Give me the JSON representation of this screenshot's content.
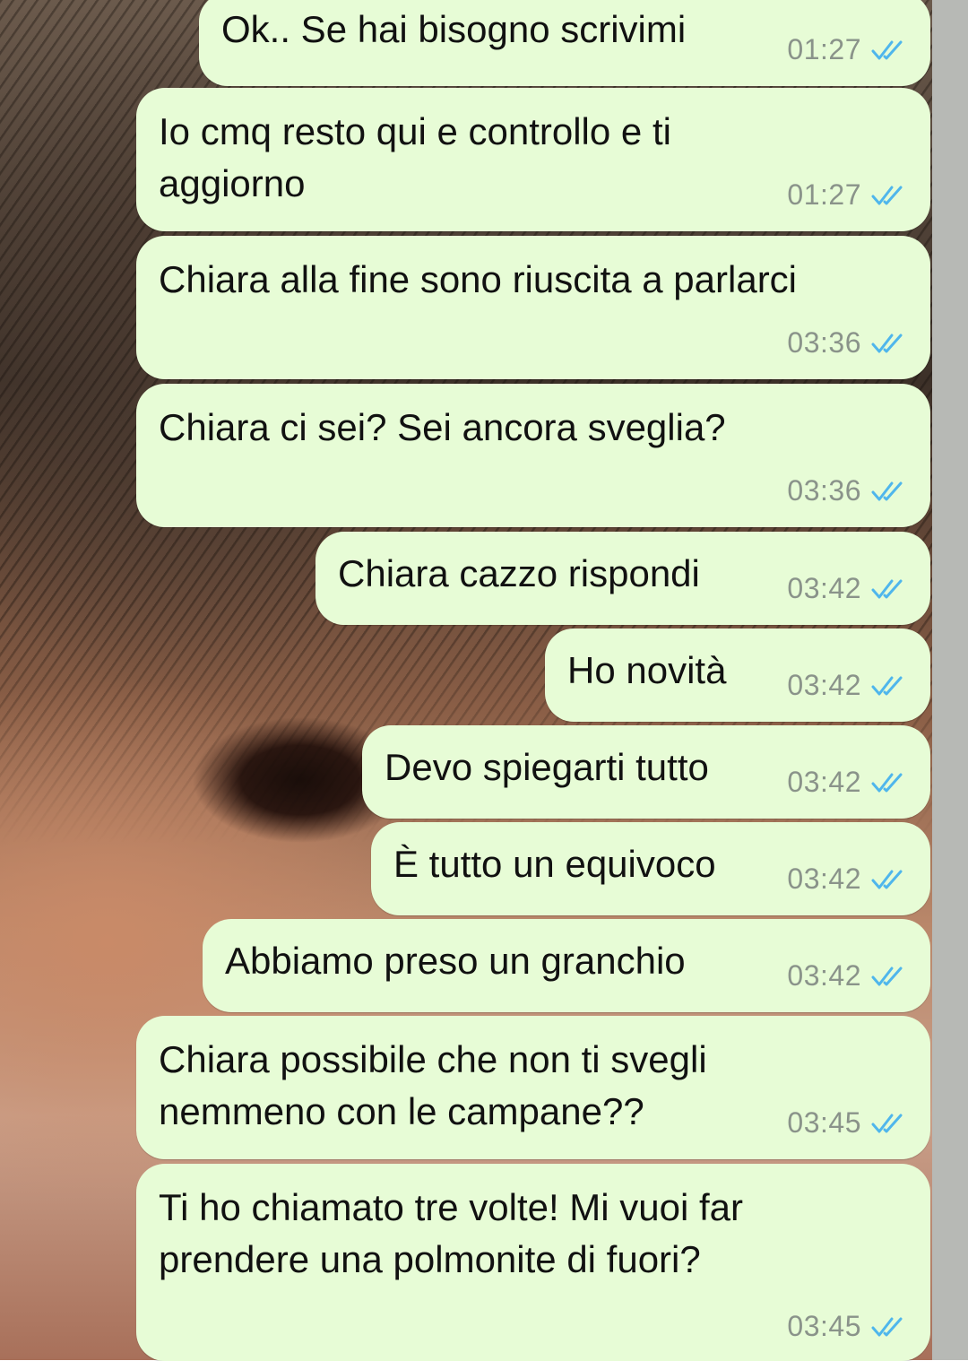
{
  "conversation": {
    "messages": [
      {
        "text": "Ok.. Se hai bisogno scrivimi",
        "time": "01:27"
      },
      {
        "text": "Io cmq resto qui e controllo e ti\naggiorno",
        "time": "01:27"
      },
      {
        "text": "Chiara alla fine sono riuscita a parlarci",
        "time": "03:36"
      },
      {
        "text": "Chiara ci sei? Sei ancora sveglia?",
        "time": "03:36"
      },
      {
        "text": "Chiara cazzo rispondi",
        "time": "03:42"
      },
      {
        "text": "Ho novità",
        "time": "03:42"
      },
      {
        "text": "Devo spiegarti tutto",
        "time": "03:42"
      },
      {
        "text": "È tutto un equivoco",
        "time": "03:42"
      },
      {
        "text": "Abbiamo preso un granchio",
        "time": "03:42"
      },
      {
        "text": "Chiara possibile che non ti svegli\nnemmeno con le campane??",
        "time": "03:45"
      },
      {
        "text": "Ti ho chiamato tre volte! Mi vuoi far\nprendere una polmonite di fuori?",
        "time": "03:45"
      }
    ],
    "read_receipt_icon": "double-check-read-icon",
    "colors": {
      "bubble": "#e7fcd6",
      "read_ticks": "#4fb6ec",
      "time": "#8a938a"
    }
  }
}
